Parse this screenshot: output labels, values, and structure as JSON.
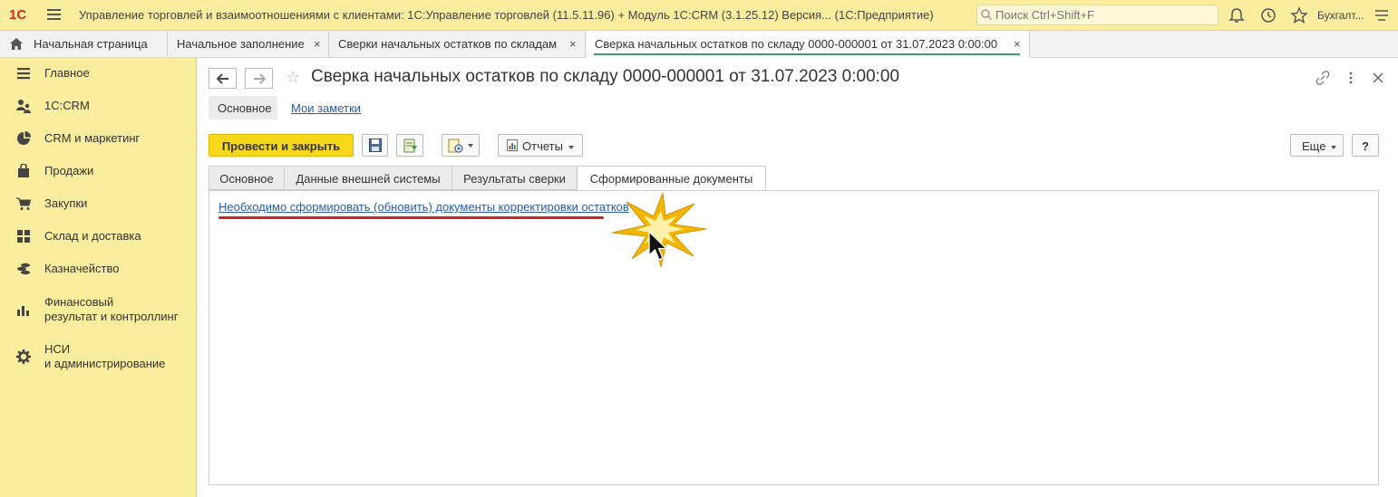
{
  "titlebar": {
    "logo": "1С",
    "app_title": "Управление торговлей и взаимоотношениями с клиентами: 1С:Управление торговлей (11.5.11.96) + Модуль 1С:CRM (3.1.25.12) Версия...   (1С:Предприятие)",
    "search_placeholder": "Поиск Ctrl+Shift+F",
    "user": "Бухгалт..."
  },
  "window_tabs": [
    {
      "label": "Начальная страница"
    },
    {
      "label": "Начальное заполнение"
    },
    {
      "label": "Сверки начальных остатков по складам"
    },
    {
      "label": "Сверка начальных остатков по складу 0000-000001 от 31.07.2023 0:00:00"
    }
  ],
  "sidebar": {
    "items": [
      {
        "label": "Главное",
        "icon": "menu-icon"
      },
      {
        "label": "1С:CRM",
        "icon": "users-icon"
      },
      {
        "label": "CRM и маркетинг",
        "icon": "pie-chart-icon"
      },
      {
        "label": "Продажи",
        "icon": "bag-icon"
      },
      {
        "label": "Закупки",
        "icon": "cart-icon"
      },
      {
        "label": "Склад и доставка",
        "icon": "grid-icon"
      },
      {
        "label": "Казначейство",
        "icon": "coins-icon"
      },
      {
        "label": "Финансовый",
        "label2": "результат и контроллинг",
        "icon": "bar-chart-icon"
      },
      {
        "label": "НСИ",
        "label2": "и администрирование",
        "icon": "gear-icon"
      }
    ]
  },
  "form": {
    "title": "Сверка начальных остатков по складу 0000-000001 от 31.07.2023 0:00:00",
    "subtabs": {
      "main": "Основное",
      "notes": "Мои заметки"
    },
    "toolbar": {
      "post_close": "Провести и закрыть",
      "reports": "Отчеты",
      "more": "Еще",
      "help": "?"
    },
    "tabs": [
      {
        "label": "Основное"
      },
      {
        "label": "Данные внешней системы"
      },
      {
        "label": "Результаты сверки"
      },
      {
        "label": "Сформированные документы"
      }
    ],
    "link_text": "Необходимо сформировать (обновить) документы корректировки остатков"
  },
  "colors": {
    "accent_yellow": "#f9d71c",
    "sidebar_bg": "#fbed9e",
    "link": "#2a5caa",
    "highlight_red": "#d81e1e"
  }
}
